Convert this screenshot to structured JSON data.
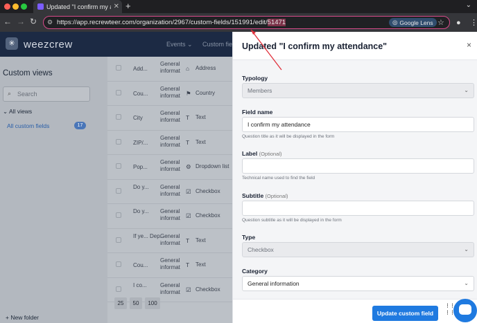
{
  "browser": {
    "tab_title": "Updated \"I confirm my attend...",
    "new_tab_symbol": "+",
    "url_prefix": "https://app.recrewteer.com/organization/2967/custom-fields/151991/edit/",
    "url_highlight": "51471",
    "lens_label": "Google Lens",
    "traffic_colors": [
      "#ff5f57",
      "#febc2e",
      "#28c840"
    ]
  },
  "app": {
    "logo_text": "weezcrew",
    "nav": {
      "events": "Events ⌄",
      "custom_fields": "Custom field"
    }
  },
  "sidebar": {
    "title": "Custom views",
    "search_placeholder": "Search",
    "all_views": "All views",
    "all_custom_fields": "All custom fields",
    "count": "17",
    "new_folder": "New folder"
  },
  "table": {
    "rows": [
      {
        "name": "Add...",
        "category": "General informat",
        "type_icon": "⌂",
        "type": "Address"
      },
      {
        "name": "Cou...",
        "category": "General informat",
        "type_icon": "⚑",
        "type": "Country"
      },
      {
        "name": "City",
        "category": "General informat",
        "type_icon": "T",
        "type": "Text"
      },
      {
        "name": "ZIP/...",
        "category": "General informat",
        "type_icon": "T",
        "type": "Text"
      },
      {
        "name": "Pop...",
        "category": "General informat",
        "type_icon": "⚙",
        "type": "Dropdown list"
      },
      {
        "name": "Do y...",
        "category": "General informat",
        "type_icon": "☑",
        "type": "Checkbox"
      },
      {
        "name": "Do y...",
        "category": "General informat",
        "type_icon": "☑",
        "type": "Checkbox"
      },
      {
        "name": "If ye... Dep...",
        "category": "General informat",
        "type_icon": "T",
        "type": "Text"
      },
      {
        "name": "Cou...",
        "category": "General informat",
        "type_icon": "T",
        "type": "Text"
      },
      {
        "name": "I co...",
        "category": "General informat",
        "type_icon": "☑",
        "type": "Checkbox"
      }
    ],
    "page_sizes": [
      "25",
      "50",
      "100"
    ]
  },
  "modal": {
    "title": "Updated \"I confirm my attendance\"",
    "close_symbol": "×",
    "typology_label": "Typology",
    "typology_value": "Members",
    "field_name_label": "Field name",
    "field_name_value": "I confirm my attendance",
    "field_name_help": "Question title as it will be displayed in the form",
    "label_label": "Label",
    "label_optional": "(Optional)",
    "label_value": "",
    "label_help": "Technical name used to find the field",
    "subtitle_label": "Subtitle",
    "subtitle_optional": "(Optional)",
    "subtitle_value": "",
    "subtitle_help": "Question subtitle as it will be displayed in the form",
    "type_label": "Type",
    "type_value": "Checkbox",
    "category_label": "Category",
    "category_value": "General information",
    "save_button": "Update custom field"
  }
}
